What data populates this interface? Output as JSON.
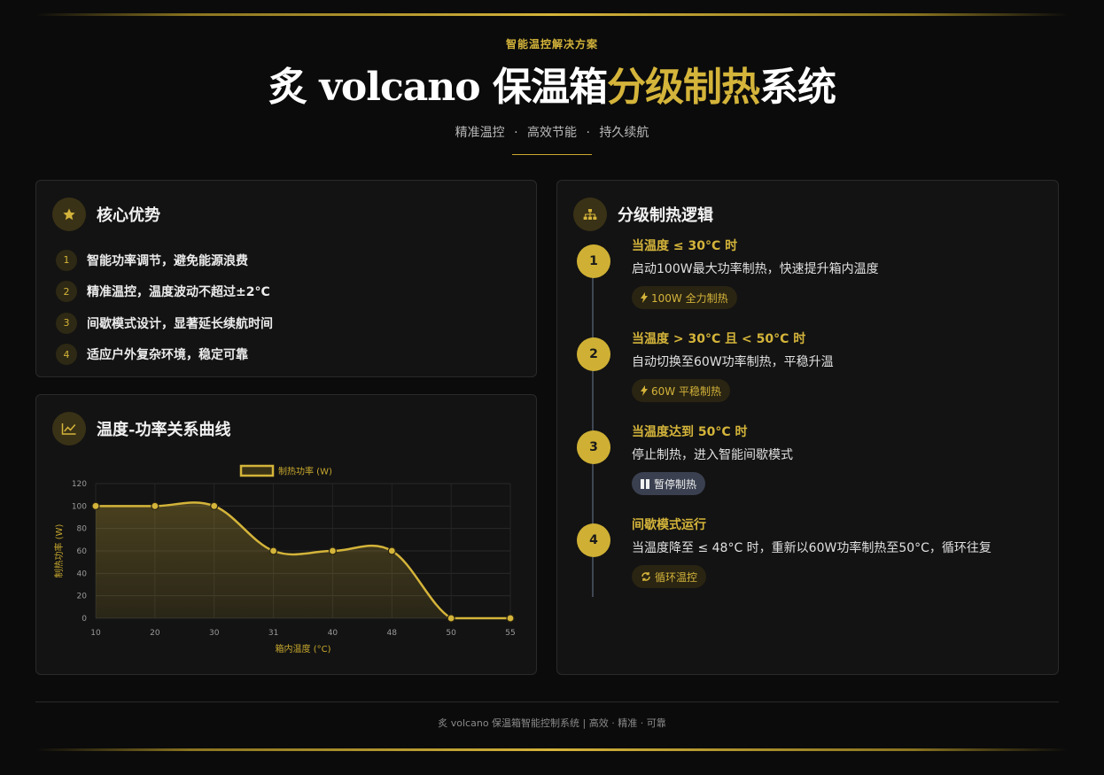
{
  "header": {
    "eyebrow": "智能温控解决方案",
    "title_prefix": "炙 volcano 保温箱",
    "title_highlight": "分级制热",
    "title_suffix": "系统",
    "subtitle_parts": [
      "精准温控",
      "高效节能",
      "持久续航"
    ],
    "separator": "·"
  },
  "advantages": {
    "title": "核心优势",
    "icon": "star-icon",
    "items": [
      {
        "num": "1",
        "text": "智能功率调节，避免能源浪费"
      },
      {
        "num": "2",
        "text": "精准温控，温度波动不超过±2°C"
      },
      {
        "num": "3",
        "text": "间歇模式设计，显著延长续航时间"
      },
      {
        "num": "4",
        "text": "适应户外复杂环境，稳定可靠"
      }
    ]
  },
  "chart_card": {
    "title": "温度-功率关系曲线",
    "icon": "line-chart-icon"
  },
  "chart_data": {
    "type": "line",
    "x": [
      "10",
      "20",
      "30",
      "31",
      "40",
      "48",
      "50",
      "55"
    ],
    "series": [
      {
        "name": "制热功率 (W)",
        "values": [
          100,
          100,
          100,
          60,
          60,
          60,
          0,
          0
        ]
      }
    ],
    "xlabel": "箱内温度 (°C)",
    "ylabel": "制热功率 (W)",
    "ylim": [
      0,
      120
    ],
    "yticks": [
      "0",
      "20",
      "40",
      "60",
      "80",
      "100",
      "120"
    ],
    "fill": true,
    "grid": true,
    "legend": "top-center",
    "color": "#d4b43a"
  },
  "logic": {
    "title": "分级制热逻辑",
    "icon": "hierarchy-icon",
    "steps": [
      {
        "num": "1",
        "title": "当温度 ≤ 30°C 时",
        "desc": "启动100W最大功率制热，快速提升箱内温度",
        "badge": "100W 全力制热",
        "badge_icon": "bolt-icon"
      },
      {
        "num": "2",
        "title": "当温度 > 30°C 且 < 50°C 时",
        "desc": "自动切换至60W功率制热，平稳升温",
        "badge": "60W 平稳制热",
        "badge_icon": "bolt-icon"
      },
      {
        "num": "3",
        "title": "当温度达到 50°C 时",
        "desc": "停止制热，进入智能间歇模式",
        "badge": "暂停制热",
        "badge_icon": "pause-icon"
      },
      {
        "num": "4",
        "title": "间歇模式运行",
        "desc": "当温度降至 ≤ 48°C 时，重新以60W功率制热至50°C，循环往复",
        "badge": "循环温控",
        "badge_icon": "refresh-icon"
      }
    ]
  },
  "footer": {
    "text": "炙 volcano 保温箱智能控制系统 | 高效 · 精准 · 可靠"
  },
  "colors": {
    "accent": "#d4b43a",
    "background": "#0b0b0b",
    "card": "#131313",
    "pause_badge": "#3a4050"
  }
}
